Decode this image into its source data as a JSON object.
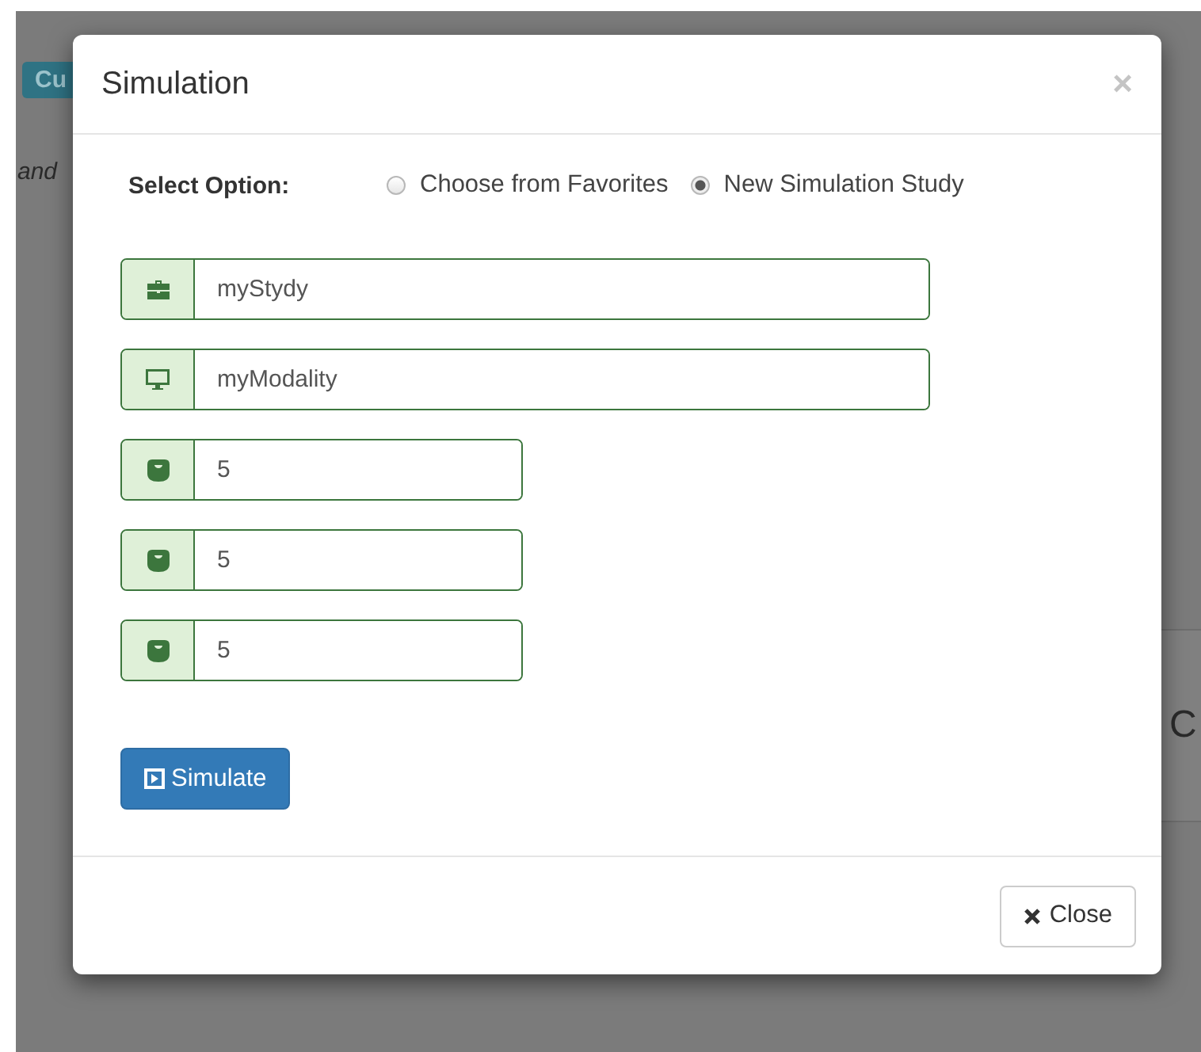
{
  "background": {
    "badge": "Cu",
    "text": "and",
    "heading": "C"
  },
  "dialog": {
    "title": "Simulation",
    "close_symbol": "×",
    "option_label": "Select Option:",
    "options": [
      {
        "label": "Choose from Favorites",
        "selected": false
      },
      {
        "label": "New Simulation Study",
        "selected": true
      }
    ],
    "fields": [
      {
        "kind": "study",
        "value": "myStydy",
        "wide": true
      },
      {
        "kind": "modality",
        "value": "myModality",
        "wide": true
      },
      {
        "kind": "gauge",
        "value": "5",
        "wide": false
      },
      {
        "kind": "gauge",
        "value": "5",
        "wide": false
      },
      {
        "kind": "gauge",
        "value": "5",
        "wide": false
      }
    ],
    "simulate_button": "Simulate",
    "close_button": "Close"
  }
}
